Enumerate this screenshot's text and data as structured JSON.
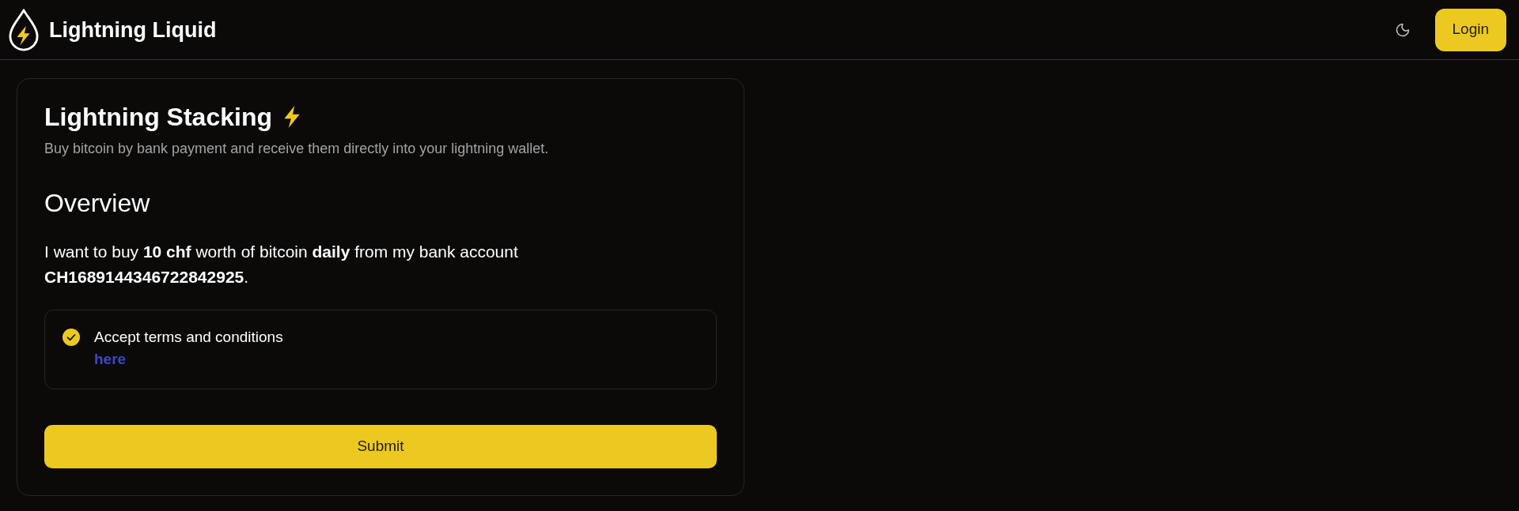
{
  "header": {
    "brand": "Lightning Liquid",
    "login_button": "Login"
  },
  "card": {
    "title": "Lightning Stacking",
    "subtitle": "Buy bitcoin by bank payment and receive them directly into your lightning wallet.",
    "section_title": "Overview",
    "summary": "I want to buy **10 chf** worth of bitcoin **daily** from my bank account **CH1689144346722842925**.",
    "terms": {
      "label": "Accept terms and conditions",
      "link": "here",
      "checked": true
    },
    "submit_button": "Submit"
  }
}
